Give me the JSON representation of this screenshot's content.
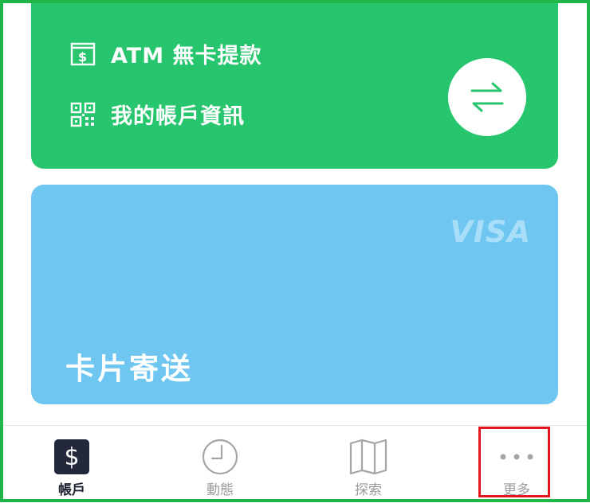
{
  "quick_actions": {
    "atm_label": "ATM 無卡提款",
    "account_info_label": "我的帳戶資訊"
  },
  "card": {
    "brand": "VISA",
    "title": "卡片寄送"
  },
  "tabbar": {
    "tabs": [
      {
        "label": "帳戶",
        "icon": "dollar-icon",
        "active": true
      },
      {
        "label": "動態",
        "icon": "clock-icon",
        "active": false
      },
      {
        "label": "探索",
        "icon": "map-icon",
        "active": false
      },
      {
        "label": "更多",
        "icon": "more-dots-icon",
        "active": false
      }
    ]
  },
  "colors": {
    "green_card": "#27c66e",
    "blue_card": "#6ec6f1",
    "active_tab": "#23283a",
    "highlight": "#e2141c",
    "frame": "#1fb548"
  }
}
